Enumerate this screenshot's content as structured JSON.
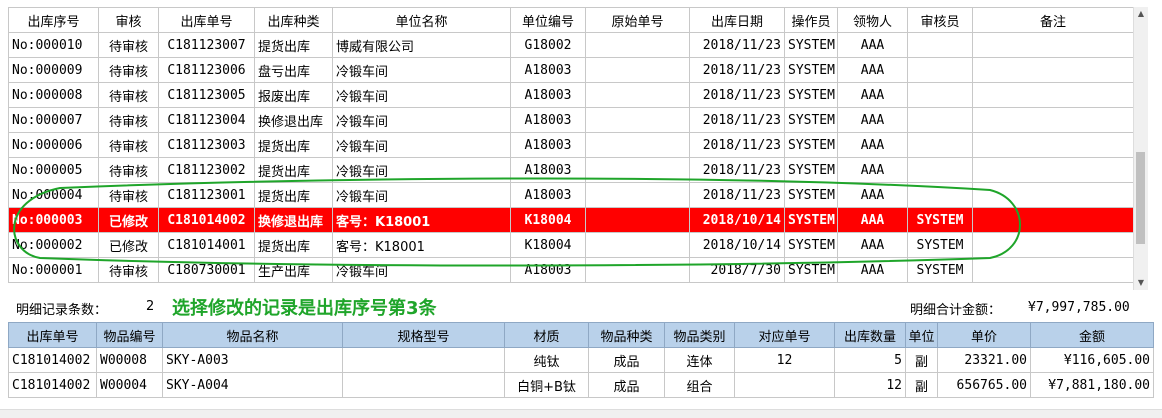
{
  "main_grid": {
    "columns": [
      "出库序号",
      "审核",
      "出库单号",
      "出库种类",
      "单位名称",
      "单位编号",
      "原始单号",
      "出库日期",
      "操作员",
      "领物人",
      "审核员",
      "备注"
    ],
    "rows": [
      {
        "seq": "No:000010",
        "audit": "待审核",
        "order_no": "C181123007",
        "type": "提货出库",
        "unit_name": "博威有限公司",
        "unit_code": "G18002",
        "orig_no": "",
        "date": "2018/11/23",
        "operator": "SYSTEM",
        "receiver": "AAA",
        "auditor": "",
        "note": ""
      },
      {
        "seq": "No:000009",
        "audit": "待审核",
        "order_no": "C181123006",
        "type": "盘亏出库",
        "unit_name": "冷锻车间",
        "unit_code": "A18003",
        "orig_no": "",
        "date": "2018/11/23",
        "operator": "SYSTEM",
        "receiver": "AAA",
        "auditor": "",
        "note": ""
      },
      {
        "seq": "No:000008",
        "audit": "待审核",
        "order_no": "C181123005",
        "type": "报废出库",
        "unit_name": "冷锻车间",
        "unit_code": "A18003",
        "orig_no": "",
        "date": "2018/11/23",
        "operator": "SYSTEM",
        "receiver": "AAA",
        "auditor": "",
        "note": ""
      },
      {
        "seq": "No:000007",
        "audit": "待审核",
        "order_no": "C181123004",
        "type": "换修退出库",
        "unit_name": "冷锻车间",
        "unit_code": "A18003",
        "orig_no": "",
        "date": "2018/11/23",
        "operator": "SYSTEM",
        "receiver": "AAA",
        "auditor": "",
        "note": ""
      },
      {
        "seq": "No:000006",
        "audit": "待审核",
        "order_no": "C181123003",
        "type": "提货出库",
        "unit_name": "冷锻车间",
        "unit_code": "A18003",
        "orig_no": "",
        "date": "2018/11/23",
        "operator": "SYSTEM",
        "receiver": "AAA",
        "auditor": "",
        "note": ""
      },
      {
        "seq": "No:000005",
        "audit": "待审核",
        "order_no": "C181123002",
        "type": "提货出库",
        "unit_name": "冷锻车间",
        "unit_code": "A18003",
        "orig_no": "",
        "date": "2018/11/23",
        "operator": "SYSTEM",
        "receiver": "AAA",
        "auditor": "",
        "note": ""
      },
      {
        "seq": "No:000004",
        "audit": "待审核",
        "order_no": "C181123001",
        "type": "提货出库",
        "unit_name": "冷锻车间",
        "unit_code": "A18003",
        "orig_no": "",
        "date": "2018/11/23",
        "operator": "SYSTEM",
        "receiver": "AAA",
        "auditor": "",
        "note": ""
      },
      {
        "seq": "No:000003",
        "audit": "已修改",
        "order_no": "C181014002",
        "type": "换修退出库",
        "unit_name": "客号：K18001",
        "unit_code": "K18004",
        "orig_no": "",
        "date": "2018/10/14",
        "operator": "SYSTEM",
        "receiver": "AAA",
        "auditor": "SYSTEM",
        "note": ""
      },
      {
        "seq": "No:000002",
        "audit": "已修改",
        "order_no": "C181014001",
        "type": "提货出库",
        "unit_name": "客号：K18001",
        "unit_code": "K18004",
        "orig_no": "",
        "date": "2018/10/14",
        "operator": "SYSTEM",
        "receiver": "AAA",
        "auditor": "SYSTEM",
        "note": ""
      },
      {
        "seq": "No:000001",
        "audit": "待审核",
        "order_no": "C180730001",
        "type": "生产出库",
        "unit_name": "冷锻车间",
        "unit_code": "A18003",
        "orig_no": "",
        "date": "2018/7/30",
        "operator": "SYSTEM",
        "receiver": "AAA",
        "auditor": "SYSTEM",
        "note": ""
      }
    ],
    "selected_index": 7,
    "selected_color": "#ff0000"
  },
  "summary": {
    "count_label": "明细记录条数：",
    "count_value": "2",
    "total_label": "明细合计金额：",
    "total_value": "¥7,997,785.00"
  },
  "annotation": {
    "text": "选择修改的记录是出库序号第3条",
    "color": "#1fa52a"
  },
  "detail_grid": {
    "columns": [
      "出库单号",
      "物品编号",
      "物品名称",
      "规格型号",
      "材质",
      "物品种类",
      "物品类别",
      "对应单号",
      "出库数量",
      "单位",
      "单价",
      "金额"
    ],
    "rows": [
      {
        "order_no": "C181014002",
        "item_code": "W00008",
        "item_name": "SKY-A003",
        "spec": "",
        "material": "纯钛",
        "kind": "成品",
        "category": "连体",
        "ref_no": "12",
        "qty": "5",
        "unit": "副",
        "price": "23321.00",
        "amount": "¥116,605.00"
      },
      {
        "order_no": "C181014002",
        "item_code": "W00004",
        "item_name": "SKY-A004",
        "spec": "",
        "material": "白铜+B钛",
        "kind": "成品",
        "category": "组合",
        "ref_no": "",
        "qty": "12",
        "unit": "副",
        "price": "656765.00",
        "amount": "¥7,881,180.00"
      }
    ],
    "header_color": "#b9d1ea"
  },
  "icons": {
    "scroll_up": "scroll-up-arrow-icon",
    "scroll_down": "scroll-down-arrow-icon"
  }
}
